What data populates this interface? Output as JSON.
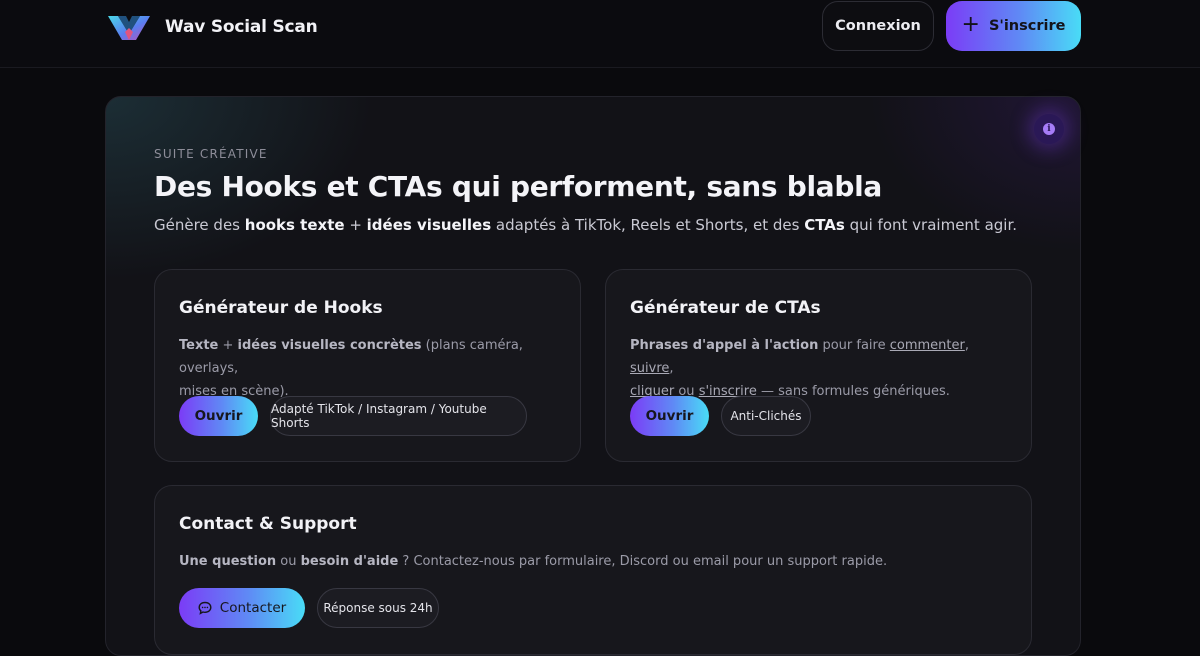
{
  "header": {
    "brand_name": "Wav Social Scan",
    "login_label": "Connexion",
    "signup_label": "S'inscrire"
  },
  "hero": {
    "eyebrow": "SUITE CRÉATIVE",
    "title": "Des Hooks et CTAs qui performent, sans blabla",
    "lead": {
      "p1": "Génère des ",
      "b1": "hooks texte",
      "p2": " + ",
      "b2": "idées visuelles",
      "p3": " adaptés à TikTok, Reels et Shorts, et des ",
      "b3": "CTAs",
      "p4": " qui font vraiment agir."
    }
  },
  "cards": {
    "hooks": {
      "title": "Générateur de Hooks",
      "text_b1": "Texte",
      "text_p1": " + ",
      "text_b2": "idées visuelles concrètes",
      "text_p2": " (plans caméra, overlays,",
      "text_p3": "mises en scène).",
      "button": "Ouvrir",
      "tag": "Adapté TikTok / Instagram / Youtube Shorts"
    },
    "ctas": {
      "title": "Générateur de CTAs",
      "text_b1": "Phrases d'appel à l'action",
      "text_p1": " pour faire ",
      "link1": "commenter",
      "text_p2": ", ",
      "link2": "suivre",
      "text_p3": ",",
      "link3": "cliquer",
      "text_p4": " ou ",
      "link4": "s'inscrire",
      "text_p5": " — sans formules génériques.",
      "button": "Ouvrir",
      "tag": "Anti-Clichés"
    },
    "contact": {
      "title": "Contact & Support",
      "text_b1": "Une question",
      "text_p1": " ou ",
      "text_b2": "besoin d'aide",
      "text_p2": " ? Contactez-nous par formulaire, Discord ou email pour un support rapide.",
      "button": "Contacter",
      "tag": "Réponse sous 24h"
    }
  },
  "colors": {
    "accent_start": "#7b3cf6",
    "accent_end": "#49dcf6",
    "background": "#0a0a0d"
  },
  "icons": {
    "logo": "wav-logo-icon",
    "signup": "plus-icon",
    "info": "info-icon",
    "contact": "chat-bubble-icon"
  }
}
